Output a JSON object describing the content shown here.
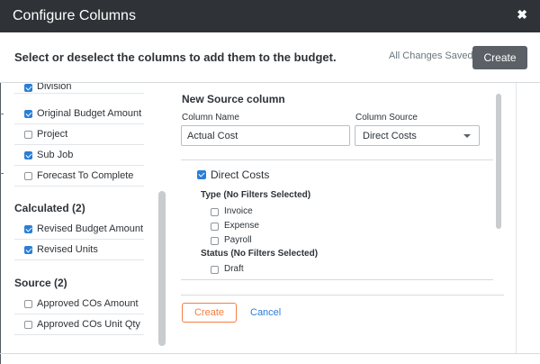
{
  "dialog": {
    "title": "Configure Columns",
    "close_glyph": "✖",
    "instructions": "Select or deselect the columns to add them to the budget.",
    "save_status": "All Changes Saved",
    "create_label": "Create"
  },
  "left_panel": {
    "standard_items": [
      {
        "label": "Division",
        "checked": true
      },
      {
        "label": "Original Budget Amount",
        "checked": true
      },
      {
        "label": "Project",
        "checked": false
      },
      {
        "label": "Sub Job",
        "checked": true
      },
      {
        "label": "Forecast To Complete",
        "checked": false
      }
    ],
    "calculated": {
      "heading": "Calculated (2)",
      "items": [
        {
          "label": "Revised Budget Amount",
          "checked": true
        },
        {
          "label": "Revised Units",
          "checked": true
        }
      ]
    },
    "source": {
      "heading": "Source (2)",
      "items": [
        {
          "label": "Approved COs Amount",
          "checked": false
        },
        {
          "label": "Approved COs Unit Qty",
          "checked": false
        }
      ]
    }
  },
  "new_source": {
    "heading": "New Source column",
    "column_name_label": "Column Name",
    "column_name_value": "Actual Cost",
    "column_source_label": "Column Source",
    "column_source_value": "Direct Costs",
    "source_checkbox_label": "Direct Costs",
    "source_checked": true,
    "type_filter_heading": "Type (No Filters Selected)",
    "type_options": [
      "Invoice",
      "Expense",
      "Payroll"
    ],
    "status_filter_heading": "Status (No Filters Selected)",
    "status_options": [
      "Draft"
    ],
    "create_label": "Create",
    "cancel_label": "Cancel"
  },
  "colors": {
    "header_bg": "#2f3237",
    "checkbox_on": "#2a7ed8",
    "accent_orange": "#f47e42",
    "link_blue": "#2a7ed8"
  }
}
